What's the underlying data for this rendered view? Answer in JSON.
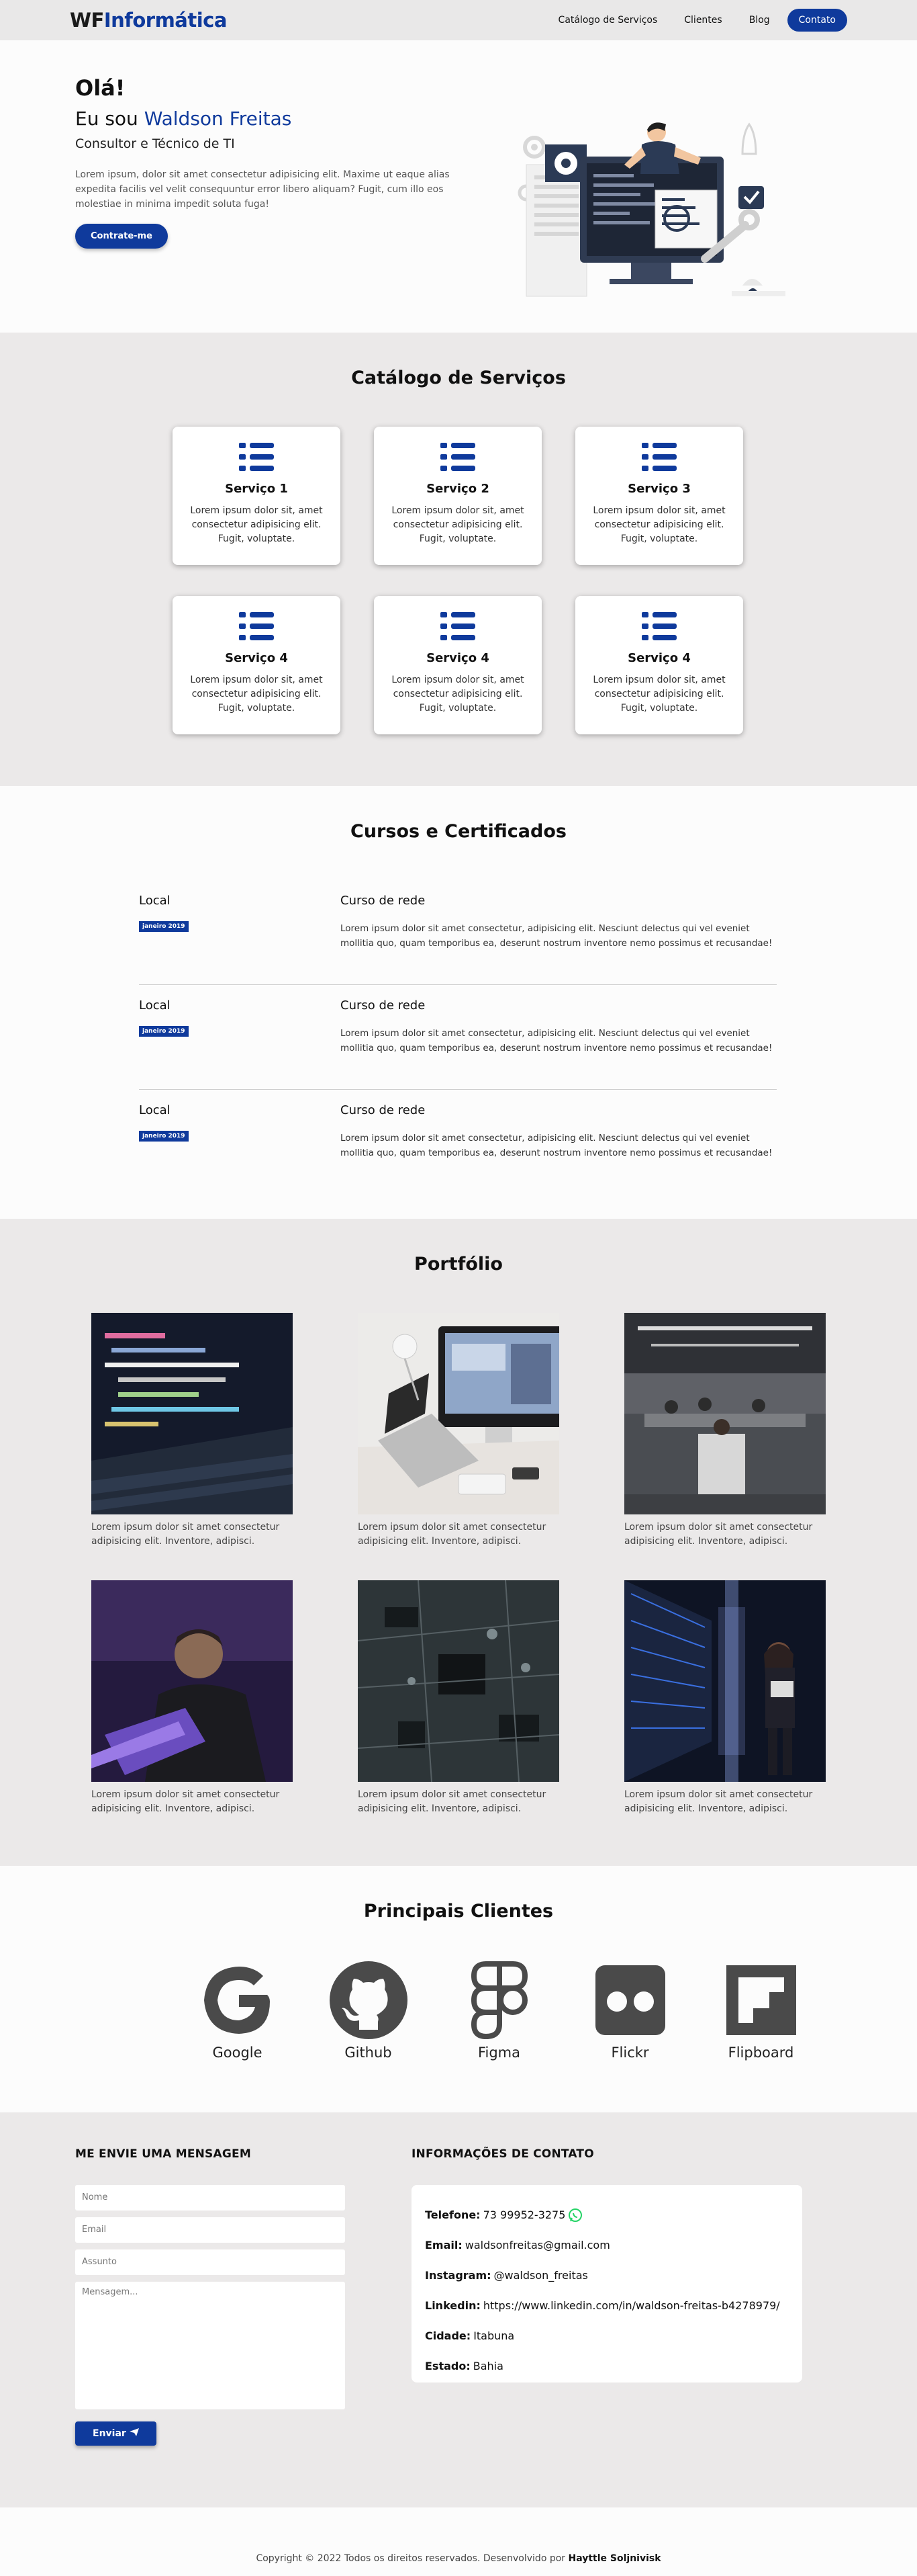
{
  "nav": {
    "brand_part1": "WF",
    "brand_part2": "Informática",
    "links": [
      "Catálogo de Serviços",
      "Clientes",
      "Blog"
    ],
    "cta": "Contato"
  },
  "hero": {
    "greeting": "Olá!",
    "intro": "Eu sou",
    "name": "Waldson Freitas",
    "role": "Consultor e Técnico de TI",
    "description": "Lorem ipsum, dolor sit amet consectetur adipisicing elit. Maxime ut eaque alias expedita facilis vel velit consequuntur error libero aliquam? Fugit, cum illo eos molestiae in minima impedit soluta fuga!",
    "button": "Contrate-me"
  },
  "services": {
    "title": "Catálogo de Serviços",
    "items": [
      {
        "title": "Serviço 1",
        "text": "Lorem ipsum dolor sit, amet consectetur adipisicing elit. Fugit, voluptate."
      },
      {
        "title": "Serviço 2",
        "text": "Lorem ipsum dolor sit, amet consectetur adipisicing elit. Fugit, voluptate."
      },
      {
        "title": "Serviço 3",
        "text": "Lorem ipsum dolor sit, amet consectetur adipisicing elit. Fugit, voluptate."
      },
      {
        "title": "Serviço 4",
        "text": "Lorem ipsum dolor sit, amet consectetur adipisicing elit. Fugit, voluptate."
      },
      {
        "title": "Serviço 4",
        "text": "Lorem ipsum dolor sit, amet consectetur adipisicing elit. Fugit, voluptate."
      },
      {
        "title": "Serviço 4",
        "text": "Lorem ipsum dolor sit, amet consectetur adipisicing elit. Fugit, voluptate."
      }
    ]
  },
  "courses": {
    "title": "Cursos e Certificados",
    "items": [
      {
        "local": "Local",
        "date": "janeiro 2019",
        "name": "Curso de rede",
        "desc": "Lorem ipsum dolor sit amet consectetur, adipisicing elit. Nesciunt delectus qui vel eveniet mollitia quo, quam temporibus ea, deserunt nostrum inventore nemo possimus et recusandae!"
      },
      {
        "local": "Local",
        "date": "janeiro 2019",
        "name": "Curso de rede",
        "desc": "Lorem ipsum dolor sit amet consectetur, adipisicing elit. Nesciunt delectus qui vel eveniet mollitia quo, quam temporibus ea, deserunt nostrum inventore nemo possimus et recusandae!"
      },
      {
        "local": "Local",
        "date": "janeiro 2019",
        "name": "Curso de rede",
        "desc": "Lorem ipsum dolor sit amet consectetur, adipisicing elit. Nesciunt delectus qui vel eveniet mollitia quo, quam temporibus ea, deserunt nostrum inventore nemo possimus et recusandae!"
      }
    ]
  },
  "portfolio": {
    "title": "Portfólio",
    "items": [
      {
        "caption": "Lorem ipsum dolor sit amet consectetur adipisicing elit. Inventore, adipisci."
      },
      {
        "caption": "Lorem ipsum dolor sit amet consectetur adipisicing elit. Inventore, adipisci."
      },
      {
        "caption": "Lorem ipsum dolor sit amet consectetur adipisicing elit. Inventore, adipisci."
      },
      {
        "caption": "Lorem ipsum dolor sit amet consectetur adipisicing elit. Inventore, adipisci."
      },
      {
        "caption": "Lorem ipsum dolor sit amet consectetur adipisicing elit. Inventore, adipisci."
      },
      {
        "caption": "Lorem ipsum dolor sit amet consectetur adipisicing elit. Inventore, adipisci."
      }
    ]
  },
  "clients": {
    "title": "Principais Clientes",
    "items": [
      "Google",
      "Github",
      "Figma",
      "Flickr",
      "Flipboard"
    ]
  },
  "contact": {
    "form_title": "ME ENVIE UMA MENSAGEM",
    "placeholders": {
      "name": "Nome",
      "email": "Email",
      "subject": "Assunto",
      "message": "Mensagem..."
    },
    "send": "Enviar",
    "info_title": "INFORMAÇÕES DE CONTATO",
    "info": [
      {
        "label": "Telefone:",
        "value": "73 99952-3275"
      },
      {
        "label": "Email:",
        "value": "waldsonfreitas@gmail.com"
      },
      {
        "label": "Instagram:",
        "value": "@waldson_freitas"
      },
      {
        "label": "Linkedin:",
        "value": "https://www.linkedin.com/in/waldson-freitas-b4278979/"
      },
      {
        "label": "Cidade:",
        "value": "Itabuna"
      },
      {
        "label": "Estado:",
        "value": "Bahia"
      }
    ]
  },
  "footer": {
    "text": "Copyright © 2022 Todos os direitos reservados. Desenvolvido por",
    "author": "Hayttle Soljnivisk"
  },
  "colors": {
    "brand": "#0f3a9c",
    "section_alt": "#ebe9e9",
    "page": "#fcfcfc",
    "whatsapp": "#25d366"
  }
}
